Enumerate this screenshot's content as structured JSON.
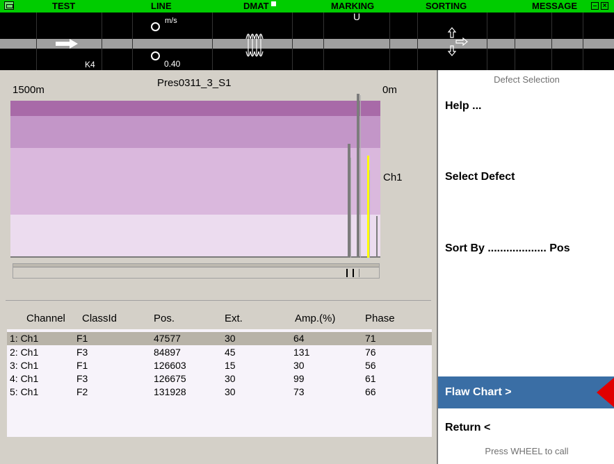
{
  "topbar": {
    "items": [
      "TEST",
      "LINE",
      "DMAT",
      "MARKING",
      "SORTING",
      "MESSAGE"
    ]
  },
  "status": {
    "speed_unit": "m/s",
    "speed_value": "0.40",
    "k_label": "K4",
    "marking_value": "U"
  },
  "chart": {
    "title": "Pres0311_3_S1",
    "left_label": "1500m",
    "right_label": "0m",
    "channel_label": "Ch1"
  },
  "table": {
    "headers": [
      "Channel",
      "ClassId",
      "Pos.",
      "Ext.",
      "Amp.(%)",
      "Phase"
    ],
    "rows": [
      [
        "1: Ch1",
        "F1",
        "47577",
        "30",
        "64",
        "71"
      ],
      [
        "2: Ch1",
        "F3",
        "84897",
        "45",
        "131",
        "76"
      ],
      [
        "3: Ch1",
        "F1",
        "126603",
        "15",
        "30",
        "56"
      ],
      [
        "4: Ch1",
        "F3",
        "126675",
        "30",
        "99",
        "61"
      ],
      [
        "5: Ch1",
        "F2",
        "131928",
        "30",
        "73",
        "66"
      ]
    ]
  },
  "menu": {
    "title": "Defect Selection",
    "help": "Help ...",
    "select_defect": "Select Defect",
    "sort_by": "Sort By ................... Pos",
    "flaw_chart": "Flaw Chart >",
    "return": "Return <",
    "hint": "Press WHEEL to call"
  },
  "colors": {
    "topbar": "#00cc00",
    "band1": "#a86aa8",
    "band2": "#c396c8",
    "band3": "#dab8dd",
    "band4": "#ecdcef",
    "selected_row": "#b8b3a8",
    "active_menu": "#3a6ea5",
    "marker": "#e00000",
    "yellow_signal": "#ffff00"
  }
}
